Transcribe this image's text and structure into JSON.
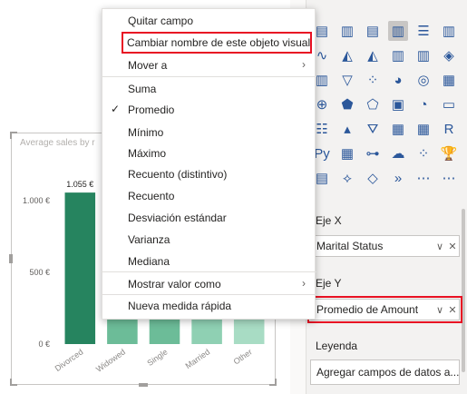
{
  "menu": {
    "items": [
      {
        "label": "Quitar campo"
      },
      {
        "label": "Cambiar nombre de este objeto visual",
        "highlighted": true
      },
      {
        "label": "Mover a",
        "submenu": true
      },
      {
        "label": "Suma"
      },
      {
        "label": "Promedio",
        "checked": true
      },
      {
        "label": "Mínimo"
      },
      {
        "label": "Máximo"
      },
      {
        "label": "Recuento (distintivo)"
      },
      {
        "label": "Recuento"
      },
      {
        "label": "Desviación estándar"
      },
      {
        "label": "Varianza"
      },
      {
        "label": "Mediana"
      },
      {
        "label": "Mostrar valor como",
        "submenu": true
      },
      {
        "label": "Nueva medida rápida"
      }
    ],
    "check_glyph": "✓",
    "chevron_glyph": "›"
  },
  "visual": {
    "title": "Average sales by r"
  },
  "chart_data": {
    "type": "bar",
    "categories": [
      "Divorced",
      "Widowed",
      "Single",
      "Married",
      "Other"
    ],
    "values": [
      1055,
      460,
      460,
      460,
      460
    ],
    "top_data_label": "1.055 €",
    "y_ticks": [
      "1.000 €",
      "500 €",
      "0 €"
    ],
    "y_tick_values": [
      1000,
      500,
      0
    ],
    "ylim": [
      0,
      1100
    ],
    "colors": [
      "#26845f",
      "#6cbc98",
      "#6cbc98",
      "#8fd0b3",
      "#a8dcc4"
    ],
    "grid": false
  },
  "panel": {
    "wells": {
      "x_label": "Eje X",
      "x_field": "Marital Status",
      "y_label": "Eje Y",
      "y_field": "Promedio de Amount",
      "legend_label": "Leyenda",
      "legend_placeholder": "Agregar campos de datos a..."
    },
    "visual_icons": [
      "stacked-bar-icon",
      "stacked-column-icon",
      "clustered-bar-icon",
      "clustered-column-icon",
      "100-bar-icon",
      "100-column-icon",
      "line-icon",
      "area-icon",
      "stacked-area-icon",
      "line-column-icon",
      "line-clustered-icon",
      "ribbon-icon",
      "waterfall-icon",
      "funnel-icon",
      "scatter-icon",
      "pie-icon",
      "donut-icon",
      "treemap-icon",
      "map-icon",
      "filled-map-icon",
      "shape-map-icon",
      "azure-map-icon",
      "gauge-icon",
      "card-icon",
      "multirow-card-icon",
      "kpi-icon",
      "slicer-icon",
      "table-icon",
      "matrix-icon",
      "r-visual-icon",
      "python-visual-icon",
      "key-influencers-icon",
      "decomposition-tree-icon",
      "qa-icon",
      "smart-narrative-icon",
      "goals-icon",
      "paginated-report-icon",
      "power-apps-icon",
      "power-automate-icon",
      "arrow-chevron-icon",
      "more-dots-icon",
      "more-dots-icon-2"
    ],
    "visual_glyphs": [
      "▤",
      "▥",
      "▤",
      "▥",
      "☰",
      "▥",
      "∿",
      "◭",
      "◭",
      "▥",
      "▥",
      "◈",
      "▥",
      "▽",
      "⁘",
      "◕",
      "◎",
      "▦",
      "⊕",
      "⬟",
      "⬠",
      "▣",
      "◔",
      "▭",
      "☷",
      "▴",
      "⛛",
      "▦",
      "▦",
      "R",
      "Py",
      "▦",
      "⊶",
      "☁",
      "⁘",
      "🏆",
      "▤",
      "⟡",
      "◇",
      "»",
      "⋯",
      "⋯"
    ],
    "selected_icon_index": 3,
    "ctl_glyphs": {
      "chevron": "∨",
      "close": "✕"
    }
  }
}
